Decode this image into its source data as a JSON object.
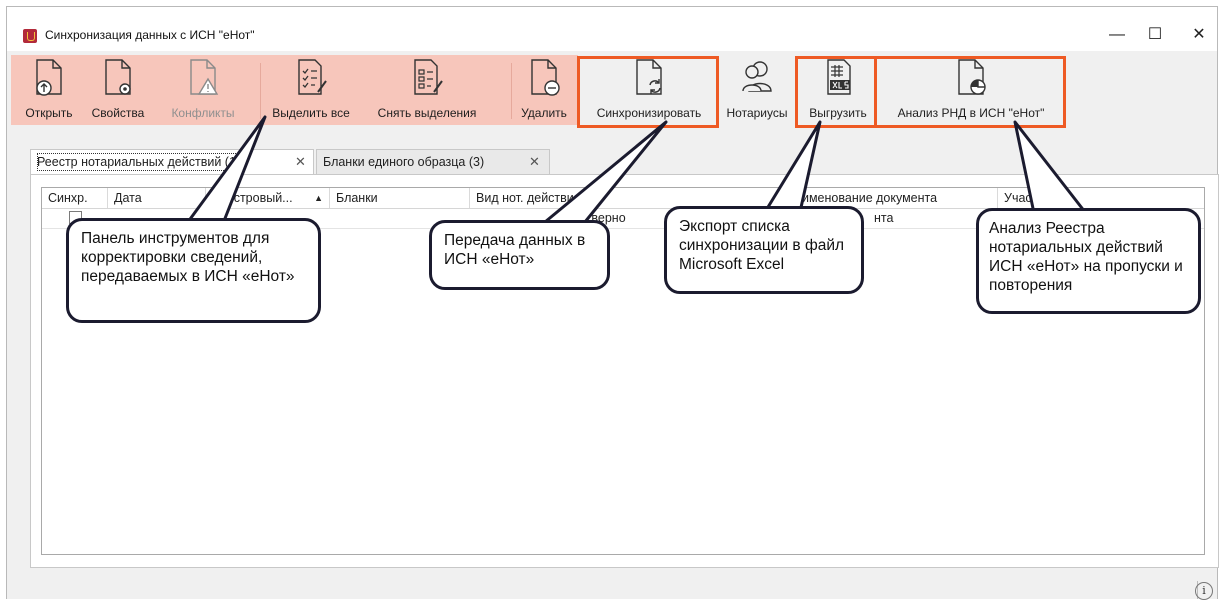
{
  "window": {
    "title": "Синхронизация данных с ИСН \"еНот\"",
    "minimize": "—",
    "maximize": "☐",
    "close": "✕"
  },
  "toolbar": {
    "open": "Открыть",
    "properties": "Свойства",
    "conflicts": "Конфликты",
    "select_all": "Выделить все",
    "deselect": "Снять выделения",
    "delete": "Удалить",
    "sync": "Синхронизировать",
    "notaries": "Нотариусы",
    "export": "Выгрузить",
    "analysis": "Анализ РНД в ИСН \"еНот\""
  },
  "tabs": [
    {
      "label": "Реестр нотариальных действий (1)"
    },
    {
      "label": "Бланки единого образца (3)"
    }
  ],
  "grid": {
    "columns": [
      "Синхр.",
      "Дата",
      "Реестровый...",
      "Бланки",
      "Вид нот. действия",
      "Наименование документа",
      "Участники"
    ],
    "sort_indicator": "▲",
    "row": [
      "ие верно",
      "нта"
    ]
  },
  "callouts": {
    "toolbar": "Панель инструментов для корректировки сведений, передаваемых в ИСН «еНот»",
    "sync": "Передача данных в ИСН «еНот»",
    "export": "Экспорт списка синхронизации в файл Microsoft Excel",
    "analysis": "Анализ Реестра нотариальных действий ИСН «еНот» на пропуски и повторения"
  },
  "status": {
    "info": "i"
  },
  "colors": {
    "toolbar_highlight": "#f7c6bb",
    "highlight_border": "#ee5a24",
    "callout_border": "#1b1b2f"
  }
}
